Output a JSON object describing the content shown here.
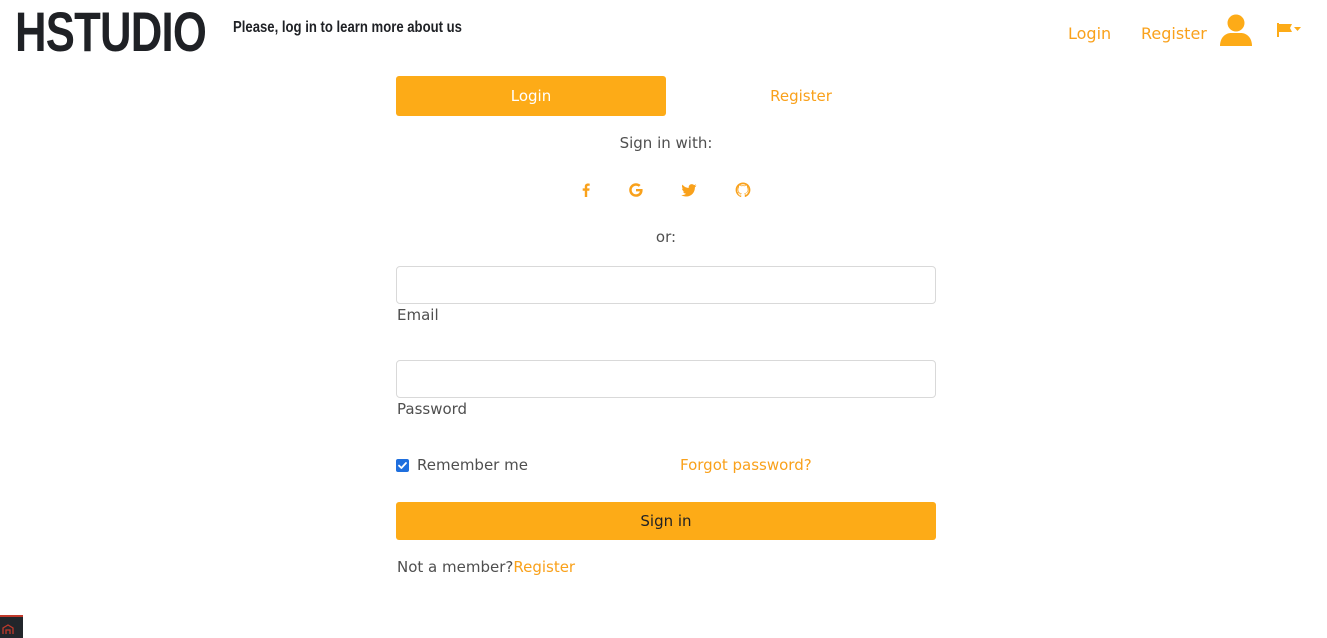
{
  "header": {
    "brand": "HSTUDIO",
    "tagline": "Please, log in to learn more about us",
    "nav_login": "Login",
    "nav_register": "Register",
    "icons": [
      "user-icon",
      "flag-icon"
    ]
  },
  "tabs": {
    "login": "Login",
    "register": "Register",
    "active": "login"
  },
  "form": {
    "sign_in_with": "Sign in with:",
    "social_icons": [
      "facebook-icon",
      "google-icon",
      "twitter-icon",
      "github-icon"
    ],
    "or": "or:",
    "email_value": "",
    "email_label": "Email",
    "password_value": "",
    "password_label": "Password",
    "remember_me": "Remember me",
    "remember_checked": true,
    "forgot_password": "Forgot password?",
    "sign_in_button": "Sign in",
    "not_member": "Not a member?",
    "register_link": "Register"
  },
  "colors": {
    "accent": "#fdab17",
    "link": "#f9a11b",
    "text": "#4f4f4f",
    "brand_text": "#1f2125",
    "checkbox": "#1f6fde"
  }
}
